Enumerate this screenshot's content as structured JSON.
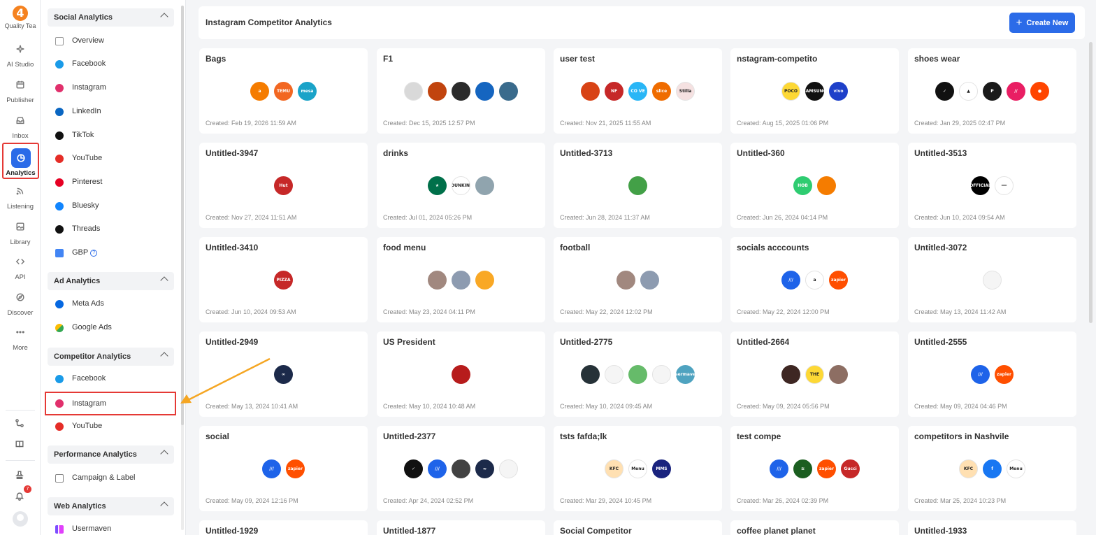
{
  "rail": {
    "brand": "Quality Tea",
    "items": [
      {
        "label": "AI Studio",
        "icon": "sparkle-icon"
      },
      {
        "label": "Publisher",
        "icon": "calendar-icon"
      },
      {
        "label": "Inbox",
        "icon": "inbox-icon"
      },
      {
        "label": "Analytics",
        "icon": "pie-chart-icon",
        "active": true
      },
      {
        "label": "Listening",
        "icon": "signal-icon"
      },
      {
        "label": "Library",
        "icon": "image-icon"
      },
      {
        "label": "API",
        "icon": "code-icon"
      },
      {
        "label": "Discover",
        "icon": "compass-icon"
      },
      {
        "label": "More",
        "icon": "ellipsis-icon"
      }
    ],
    "notification_count": "7"
  },
  "sidebar": {
    "social": {
      "title": "Social Analytics",
      "items": [
        "Overview",
        "Facebook",
        "Instagram",
        "LinkedIn",
        "TikTok",
        "YouTube",
        "Pinterest",
        "Bluesky",
        "Threads",
        "GBP"
      ],
      "help_mark": "?"
    },
    "ad": {
      "title": "Ad Analytics",
      "items": [
        "Meta Ads",
        "Google Ads"
      ]
    },
    "competitor": {
      "title": "Competitor Analytics",
      "items": [
        "Facebook",
        "Instagram",
        "YouTube"
      ],
      "active": "Instagram"
    },
    "performance": {
      "title": "Performance Analytics",
      "items": [
        "Campaign & Label"
      ]
    },
    "web": {
      "title": "Web Analytics",
      "items": [
        "Usermaven"
      ]
    }
  },
  "header": {
    "title": "Instagram Competitor Analytics",
    "create_label": "Create New",
    "create_icon": "+"
  },
  "cards": [
    {
      "title": "Bags",
      "created": "Created: Feb 19, 2026 11:59 AM",
      "avatars": [
        {
          "c": "#f57c00",
          "t": "a"
        },
        {
          "c": "#f26722",
          "t": "TEMU"
        },
        {
          "c": "#1aa3c8",
          "t": "mesa"
        }
      ]
    },
    {
      "title": "F1",
      "created": "Created: Dec 15, 2025 12:57 PM",
      "avatars": [
        {
          "c": "#d9d9d9",
          "t": ""
        },
        {
          "c": "#c1440e",
          "t": ""
        },
        {
          "c": "#2b2b2b",
          "t": ""
        },
        {
          "c": "#1565c0",
          "t": ""
        },
        {
          "c": "#3a6b8c",
          "t": ""
        }
      ]
    },
    {
      "title": "user test",
      "created": "Created: Nov 21, 2025 11:55 AM",
      "avatars": [
        {
          "c": "#d84315",
          "t": ""
        },
        {
          "c": "#c62828",
          "t": "NF"
        },
        {
          "c": "#29b6f6",
          "t": "CO VE"
        },
        {
          "c": "#ef6c00",
          "t": "slice"
        },
        {
          "c": "#f5e1e1",
          "t": "Stilla"
        }
      ]
    },
    {
      "title": "nstagram-competito",
      "created": "Created: Aug 15, 2025 01:06 PM",
      "avatars": [
        {
          "c": "#fdd835",
          "t": "POCO"
        },
        {
          "c": "#111111",
          "t": "SAMSUNG"
        },
        {
          "c": "#1e40c9",
          "t": "vivo"
        }
      ]
    },
    {
      "title": "shoes wear",
      "created": "Created: Jan 29, 2025 02:47 PM",
      "avatars": [
        {
          "c": "#111111",
          "t": "✓"
        },
        {
          "c": "#ffffff",
          "t": "▲"
        },
        {
          "c": "#1a1a1a",
          "t": "P"
        },
        {
          "c": "#e91e63",
          "t": "//"
        },
        {
          "c": "#ff4500",
          "t": "●"
        }
      ]
    },
    {
      "title": "Untitled-3947",
      "created": "Created: Nov 27, 2024 11:51 AM",
      "avatars": [
        {
          "c": "#c62828",
          "t": "Hut"
        }
      ]
    },
    {
      "title": "drinks",
      "created": "Created: Jul 01, 2024 05:26 PM",
      "avatars": [
        {
          "c": "#00704a",
          "t": "★"
        },
        {
          "c": "#ffffff",
          "t": "DUNKIN'"
        },
        {
          "c": "#90a4ae",
          "t": ""
        }
      ]
    },
    {
      "title": "Untitled-3713",
      "created": "Created: Jun 28, 2024 11:37 AM",
      "avatars": [
        {
          "c": "#43a047",
          "t": ""
        }
      ]
    },
    {
      "title": "Untitled-360",
      "created": "Created: Jun 26, 2024 04:14 PM",
      "avatars": [
        {
          "c": "#2ecc71",
          "t": "HOB"
        },
        {
          "c": "#f57c00",
          "t": ""
        }
      ]
    },
    {
      "title": "Untitled-3513",
      "created": "Created: Jun 10, 2024 09:54 AM",
      "avatars": [
        {
          "c": "#000000",
          "t": "OFFICIAL"
        },
        {
          "c": "#ffffff",
          "t": "━━"
        }
      ]
    },
    {
      "title": "Untitled-3410",
      "created": "Created: Jun 10, 2024 09:53 AM",
      "avatars": [
        {
          "c": "#c62828",
          "t": "PIZZA"
        }
      ]
    },
    {
      "title": "food menu",
      "created": "Created: May 23, 2024 04:11 PM",
      "avatars": [
        {
          "c": "#a1887f",
          "t": ""
        },
        {
          "c": "#8d9bb0",
          "t": ""
        },
        {
          "c": "#f9a825",
          "t": ""
        }
      ]
    },
    {
      "title": "football",
      "created": "Created: May 22, 2024 12:02 PM",
      "avatars": [
        {
          "c": "#a1887f",
          "t": ""
        },
        {
          "c": "#8d9bb0",
          "t": ""
        }
      ]
    },
    {
      "title": "socials acccounts",
      "created": "Created: May 22, 2024 12:00 PM",
      "avatars": [
        {
          "c": "#1e63e9",
          "t": "///"
        },
        {
          "c": "#ffffff",
          "t": "a"
        },
        {
          "c": "#ff4f00",
          "t": "zapier"
        }
      ]
    },
    {
      "title": "Untitled-3072",
      "created": "Created: May 13, 2024 11:42 AM",
      "avatars": [
        {
          "c": "#f5f5f5",
          "t": ""
        }
      ]
    },
    {
      "title": "Untitled-2949",
      "created": "Created: May 13, 2024 10:41 AM",
      "avatars": [
        {
          "c": "#1c2a4a",
          "t": "∞"
        }
      ]
    },
    {
      "title": "US President",
      "created": "Created: May 10, 2024 10:48 AM",
      "avatars": [
        {
          "c": "#b71c1c",
          "t": ""
        }
      ]
    },
    {
      "title": "Untitled-2775",
      "created": "Created: May 10, 2024 09:45 AM",
      "avatars": [
        {
          "c": "#263238",
          "t": ""
        },
        {
          "c": "#f5f5f5",
          "t": ""
        },
        {
          "c": "#66bb6a",
          "t": ""
        },
        {
          "c": "#f5f5f5",
          "t": ""
        },
        {
          "c": "#4fa3c0",
          "t": "usermaven"
        }
      ]
    },
    {
      "title": "Untitled-2664",
      "created": "Created: May 09, 2024 05:56 PM",
      "avatars": [
        {
          "c": "#3e2723",
          "t": ""
        },
        {
          "c": "#fdd835",
          "t": "THE"
        },
        {
          "c": "#8d6e63",
          "t": ""
        }
      ]
    },
    {
      "title": "Untitled-2555",
      "created": "Created: May 09, 2024 04:46 PM",
      "avatars": [
        {
          "c": "#1e63e9",
          "t": "///"
        },
        {
          "c": "#ff4f00",
          "t": "zapier"
        }
      ]
    },
    {
      "title": "social",
      "created": "Created: May 09, 2024 12:16 PM",
      "avatars": [
        {
          "c": "#1e63e9",
          "t": "///"
        },
        {
          "c": "#ff4f00",
          "t": "zapier"
        }
      ]
    },
    {
      "title": "Untitled-2377",
      "created": "Created: Apr 24, 2024 02:52 PM",
      "avatars": [
        {
          "c": "#111111",
          "t": "✓"
        },
        {
          "c": "#1e63e9",
          "t": "///"
        },
        {
          "c": "#424242",
          "t": ""
        },
        {
          "c": "#1c2a4a",
          "t": "∞"
        },
        {
          "c": "#f5f5f5",
          "t": ""
        }
      ]
    },
    {
      "title": "tsts fafda;lk",
      "created": "Created: Mar 29, 2024 10:45 PM",
      "avatars": [
        {
          "c": "#ffe0b2",
          "t": "KFC"
        },
        {
          "c": "#ffffff",
          "t": "Menu"
        },
        {
          "c": "#1a237e",
          "t": "MMS"
        }
      ]
    },
    {
      "title": "test compe",
      "created": "Created: Mar 26, 2024 02:39 PM",
      "avatars": [
        {
          "c": "#1e63e9",
          "t": "///"
        },
        {
          "c": "#1b5e20",
          "t": "≋"
        },
        {
          "c": "#ff4f00",
          "t": "zapier"
        },
        {
          "c": "#c62828",
          "t": "Gucci"
        }
      ]
    },
    {
      "title": "competitors in Nashvile",
      "created": "Created: Mar 25, 2024 10:23 PM",
      "avatars": [
        {
          "c": "#ffe0b2",
          "t": "KFC"
        },
        {
          "c": "#1877f2",
          "t": "f"
        },
        {
          "c": "#ffffff",
          "t": "Menu"
        }
      ]
    },
    {
      "title": "Untitled-1929",
      "created": "",
      "avatars": []
    },
    {
      "title": "Untitled-1877",
      "created": "",
      "avatars": []
    },
    {
      "title": "Social Competitor",
      "created": "",
      "avatars": []
    },
    {
      "title": "coffee planet planet",
      "created": "",
      "avatars": []
    },
    {
      "title": "Untitled-1933",
      "created": "",
      "avatars": []
    }
  ]
}
